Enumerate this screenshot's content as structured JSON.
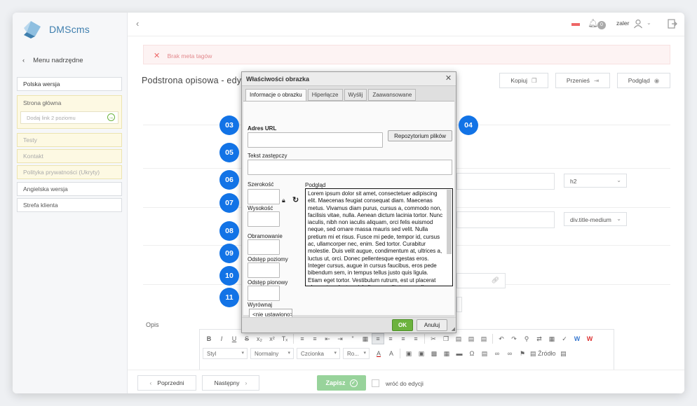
{
  "app": {
    "name": "DMScms"
  },
  "sidebar": {
    "menu_up": "Menu nadrzędne",
    "items": [
      {
        "label": "Polska wersja"
      },
      {
        "label": "Strona główna"
      },
      {
        "label": "Dodaj link 2 poziomu"
      },
      {
        "label": "Testy"
      },
      {
        "label": "Kontakt"
      },
      {
        "label": "Polityka prywatności (Ukryty)"
      },
      {
        "label": "Angielska wersja"
      },
      {
        "label": "Strefa klienta"
      }
    ]
  },
  "topbar": {
    "notifications": "0",
    "user": "zaler"
  },
  "alert": {
    "text": "Brak meta tagów"
  },
  "page": {
    "title": "Podstrona opisowa - edy"
  },
  "toolbar": {
    "copy": "Kopiuj",
    "move": "Przenieś",
    "preview": "Podgląd"
  },
  "form": {
    "heading_select": "h2",
    "class_select": "div.title-medium",
    "opis_label": "Opis"
  },
  "editor": {
    "style": "Styl",
    "format": "Normalny",
    "font": "Czcionka",
    "size": "Ro...",
    "source": "Źródło"
  },
  "footer": {
    "prev": "Poprzedni",
    "next": "Następny",
    "save": "Zapisz",
    "return_label": "wróć do edycji"
  },
  "dialog": {
    "title": "Właściwości obrazka",
    "tabs": [
      "Informacje o obrazku",
      "Hiperłącze",
      "Wyślij",
      "Zaawansowane"
    ],
    "url_label": "Adres URL",
    "browse_button": "Repozytorium plików",
    "alt_label": "Tekst zastępczy",
    "width_label": "Szerokość",
    "height_label": "Wysokość",
    "border_label": "Obramowanie",
    "hspace_label": "Odstęp poziomy",
    "vspace_label": "Odstęp pionowy",
    "align_label": "Wyrównaj",
    "align_value": "<nie ustawiono>",
    "preview_label": "Podgląd",
    "preview_text": "Lorem ipsum dolor sit amet, consectetuer adipiscing elit. Maecenas feugiat consequat diam. Maecenas metus. Vivamus diam purus, cursus a, commodo non, facilisis vitae, nulla. Aenean dictum lacinia tortor. Nunc iaculis, nibh non iaculis aliquam, orci felis euismod neque, sed ornare massa mauris sed velit. Nulla pretium mi et risus. Fusce mi pede, tempor id, cursus ac, ullamcorper nec, enim. Sed tortor. Curabitur molestie. Duis velit augue, condimentum at, ultrices a, luctus ut, orci. Donec pellentesque egestas eros. Integer cursus, augue in cursus faucibus, eros pede bibendum sem, in tempus tellus justo quis ligula. Etiam eget tortor. Vestibulum rutrum, est ut placerat elementum, lectus nisl aliquam velit, tempor aliquam",
    "ok": "OK",
    "cancel": "Anuluj"
  },
  "markers": [
    "03",
    "04",
    "05",
    "06",
    "07",
    "08",
    "09",
    "10",
    "11"
  ],
  "colors": {
    "marker": "#1273e6",
    "ok": "#6cb33e",
    "save": "#98d39b",
    "alert_bg": "#fdf3f3",
    "brand": "#3f7fae"
  }
}
